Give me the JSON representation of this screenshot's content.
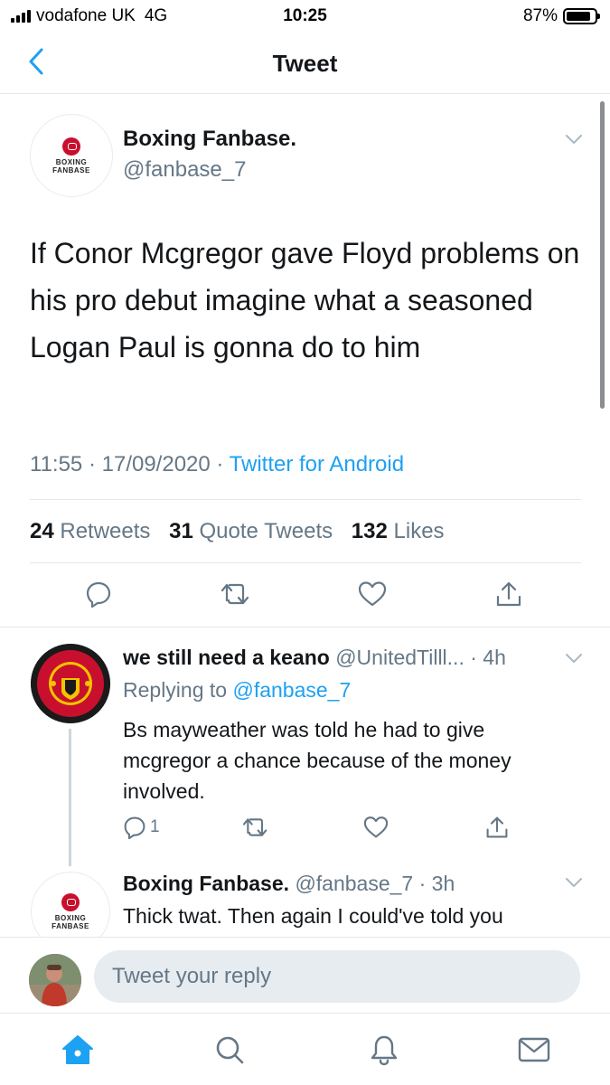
{
  "status_bar": {
    "carrier": "vodafone UK",
    "network": "4G",
    "time": "10:25",
    "battery": "87%",
    "battery_level": 0.87
  },
  "header": {
    "title": "Tweet",
    "back_icon": "chevron-left-icon"
  },
  "main_tweet": {
    "author_name": "Boxing Fanbase.",
    "author_handle": "@fanbase_7",
    "avatar_text": [
      "BOXING",
      "FANBASE"
    ],
    "text": "If Conor Mcgregor gave Floyd problems on his pro debut imagine what a seasoned Logan Paul is gonna do to him",
    "time": "11:55",
    "date": "17/09/2020",
    "separator": "·",
    "source": "Twitter for Android",
    "retweets": "24",
    "retweets_label": "Retweets",
    "quote_tweets": "31",
    "quote_tweets_label": "Quote Tweets",
    "likes": "132",
    "likes_label": "Likes"
  },
  "replies": [
    {
      "author_name": "we still need a keano",
      "author_handle": "@UnitedTilll...",
      "age": "· 4h",
      "replying_to_label": "Replying to",
      "replying_to_handle": "@fanbase_7",
      "text": "Bs mayweather was told he had to give mcgregor a chance because of the money involved.",
      "reply_count": "1",
      "avatar_text": [
        "MANCHESTER",
        "UNITED"
      ]
    },
    {
      "author_name": "Boxing Fanbase.",
      "author_handle": "@fanbase_7",
      "age": "· 3h",
      "text": "Thick twat. Then again I could've told you",
      "avatar_text": [
        "BOXING",
        "FANBASE"
      ]
    }
  ],
  "compose": {
    "placeholder": "Tweet your reply"
  },
  "colors": {
    "accent": "#1da1f2",
    "muted": "#657786",
    "divider": "#e1e8ed"
  },
  "nav": [
    "home-icon",
    "search-icon",
    "notifications-icon",
    "messages-icon"
  ]
}
